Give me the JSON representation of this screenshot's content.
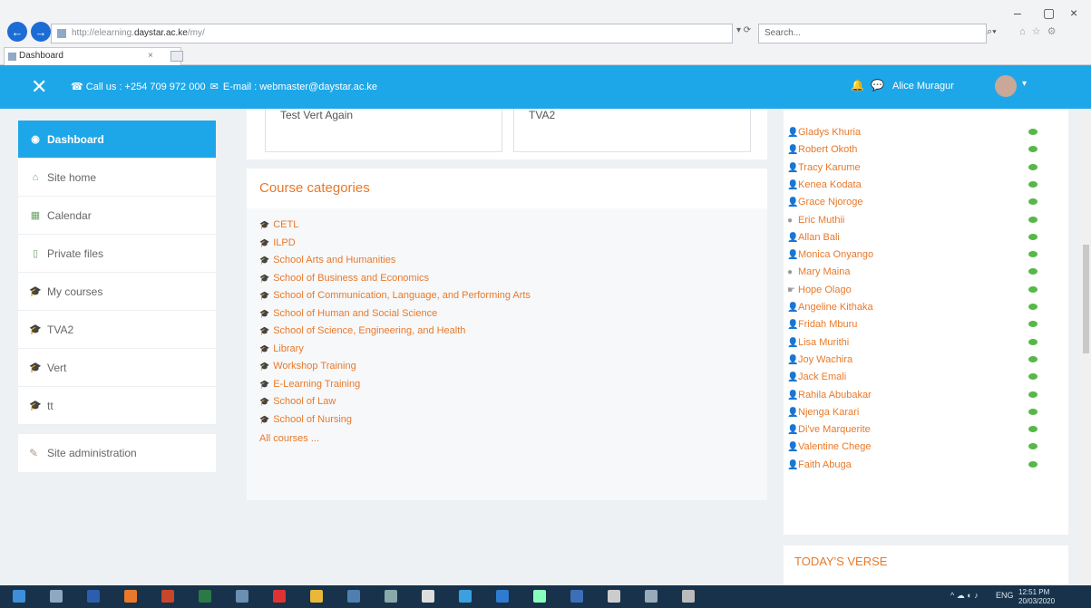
{
  "browser": {
    "url_prefix": "http://elearning.",
    "url_domain": "daystar.ac.ke",
    "url_suffix": "/my/",
    "addr_tools": "▾ ⟳",
    "search_placeholder": "Search...",
    "search_glyph": "⌕▾",
    "tab_title": "Dashboard",
    "tab_close": "×",
    "fav_glyphs": "⌂ ☆ ⚙",
    "win_min": "–",
    "win_max": "▢",
    "win_close": "×"
  },
  "header": {
    "close_glyph": "✕",
    "phone_glyph": "☎",
    "call_us": "Call us : +254 709 972 000",
    "email_glyph": "✉",
    "email": "E-mail : webmaster@daystar.ac.ke",
    "bell_glyph": "🔔",
    "chat_glyph": "💬",
    "user_name": "Alice Muragur",
    "caret": "▾"
  },
  "leftnav": {
    "items": [
      {
        "label": "Dashboard",
        "icon": "dashboard-icon",
        "glyph": "◉",
        "active": true
      },
      {
        "label": "Site home",
        "icon": "home-icon",
        "glyph": "⌂"
      },
      {
        "label": "Calendar",
        "icon": "calendar-icon",
        "glyph": "▦"
      },
      {
        "label": "Private files",
        "icon": "file-icon",
        "glyph": "▯"
      },
      {
        "label": "My courses",
        "icon": "graduation-cap-icon",
        "glyph": "🎓"
      },
      {
        "label": "TVA2",
        "icon": "graduation-cap-icon",
        "glyph": "🎓"
      },
      {
        "label": "Vert",
        "icon": "graduation-cap-icon",
        "glyph": "🎓"
      },
      {
        "label": "tt",
        "icon": "graduation-cap-icon",
        "glyph": "🎓"
      }
    ],
    "admin": {
      "label": "Site administration",
      "glyph": "✎"
    }
  },
  "cards": {
    "card1": "Test Vert Again",
    "card2": "TVA2"
  },
  "categories": {
    "title": "Course categories",
    "items": [
      "CETL",
      "ILPD",
      "School Arts and Humanities",
      "School of Business and Economics",
      "School of Communication, Language, and Performing Arts",
      "School of Human and Social Science",
      "School of Science, Engineering, and Health",
      "Library",
      "Workshop Training",
      "E-Learning Training",
      "School of Law",
      "School of Nursing"
    ],
    "all_courses": "All courses ...",
    "glyph": "🎓"
  },
  "users": [
    {
      "name": "Gladys Khuria",
      "glyph": "👤"
    },
    {
      "name": "Robert Okoth",
      "glyph": "👤"
    },
    {
      "name": "Tracy Karume",
      "glyph": "👤"
    },
    {
      "name": "Kenea Kodata",
      "glyph": "👤"
    },
    {
      "name": "Grace Njoroge",
      "glyph": "👤"
    },
    {
      "name": "Eric Muthii",
      "glyph": "●"
    },
    {
      "name": "Allan Bali",
      "glyph": "👤"
    },
    {
      "name": "Monica Onyango",
      "glyph": "👤"
    },
    {
      "name": "Mary Maina",
      "glyph": "●"
    },
    {
      "name": "Hope Olago",
      "glyph": "☛"
    },
    {
      "name": "Angeline Kithaka",
      "glyph": "👤"
    },
    {
      "name": "Fridah Mburu",
      "glyph": "👤"
    },
    {
      "name": "Lisa Murithi",
      "glyph": "👤"
    },
    {
      "name": "Joy Wachira",
      "glyph": "👤"
    },
    {
      "name": "Jack Emali",
      "glyph": "👤"
    },
    {
      "name": "Rahila Abubakar",
      "glyph": "👤"
    },
    {
      "name": "Njenga Karari",
      "glyph": "👤"
    },
    {
      "name": "Di've Marquerite",
      "glyph": "👤"
    },
    {
      "name": "Valentine Chege",
      "glyph": "👤"
    },
    {
      "name": "Faith Abuga",
      "glyph": "👤"
    }
  ],
  "verse": {
    "title": "TODAY'S VERSE"
  },
  "taskbar": {
    "lang": "ENG",
    "time": "12:51 PM",
    "date": "20/03/2020",
    "tray_glyphs": "^ ☁ ◐ ♪"
  },
  "colors": {
    "header_blue": "#1ea7e8",
    "link_orange": "#e8792a",
    "icon_green": "#6fa56b",
    "online_green": "#55b848"
  }
}
